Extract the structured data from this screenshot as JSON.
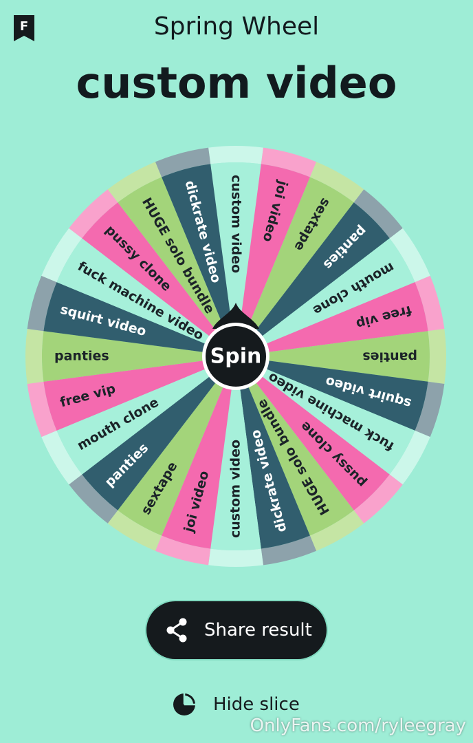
{
  "header": {
    "app_title": "Spring Wheel",
    "result": "custom video"
  },
  "wheel": {
    "spin_label": "Spin",
    "colors": {
      "teal_light": "#a6f0da",
      "pink": "#f46aaf",
      "green": "#a3d47a",
      "navy": "#315e6e",
      "background": "#9eedd6"
    },
    "rim_colors": {
      "teal_light": "#ccf7ea",
      "pink": "#f9a2cc",
      "green": "#c5e5a4",
      "navy": "#8da2ab"
    },
    "segments": [
      {
        "label": "custom video",
        "color": "teal_light"
      },
      {
        "label": "joi video",
        "color": "pink"
      },
      {
        "label": "sextape",
        "color": "green"
      },
      {
        "label": "panties",
        "color": "navy"
      },
      {
        "label": "mouth clone",
        "color": "teal_light"
      },
      {
        "label": "free vip",
        "color": "pink"
      },
      {
        "label": "panties",
        "color": "green"
      },
      {
        "label": "squirt video",
        "color": "navy"
      },
      {
        "label": "fuck machine video",
        "color": "teal_light"
      },
      {
        "label": "pussy clone",
        "color": "pink"
      },
      {
        "label": "HUGE solo bundle",
        "color": "green"
      },
      {
        "label": "dickrate video",
        "color": "navy"
      },
      {
        "label": "custom video",
        "color": "teal_light"
      },
      {
        "label": "joi video",
        "color": "pink"
      },
      {
        "label": "sextape",
        "color": "green"
      },
      {
        "label": "panties",
        "color": "navy"
      },
      {
        "label": "mouth clone",
        "color": "teal_light"
      },
      {
        "label": "free vip",
        "color": "pink"
      },
      {
        "label": "panties",
        "color": "green"
      },
      {
        "label": "squirt video",
        "color": "navy"
      },
      {
        "label": "fuck machine video",
        "color": "teal_light"
      },
      {
        "label": "pussy clone",
        "color": "pink"
      },
      {
        "label": "HUGE solo bundle",
        "color": "green"
      },
      {
        "label": "dickrate video",
        "color": "navy"
      }
    ]
  },
  "actions": {
    "share_label": "Share result",
    "hide_label": "Hide slice"
  },
  "watermark": "OnlyFans.com/ryleegray",
  "icons": {
    "brand": "brand-logo-icon",
    "share": "share-icon",
    "hide": "pie-chart-icon"
  }
}
